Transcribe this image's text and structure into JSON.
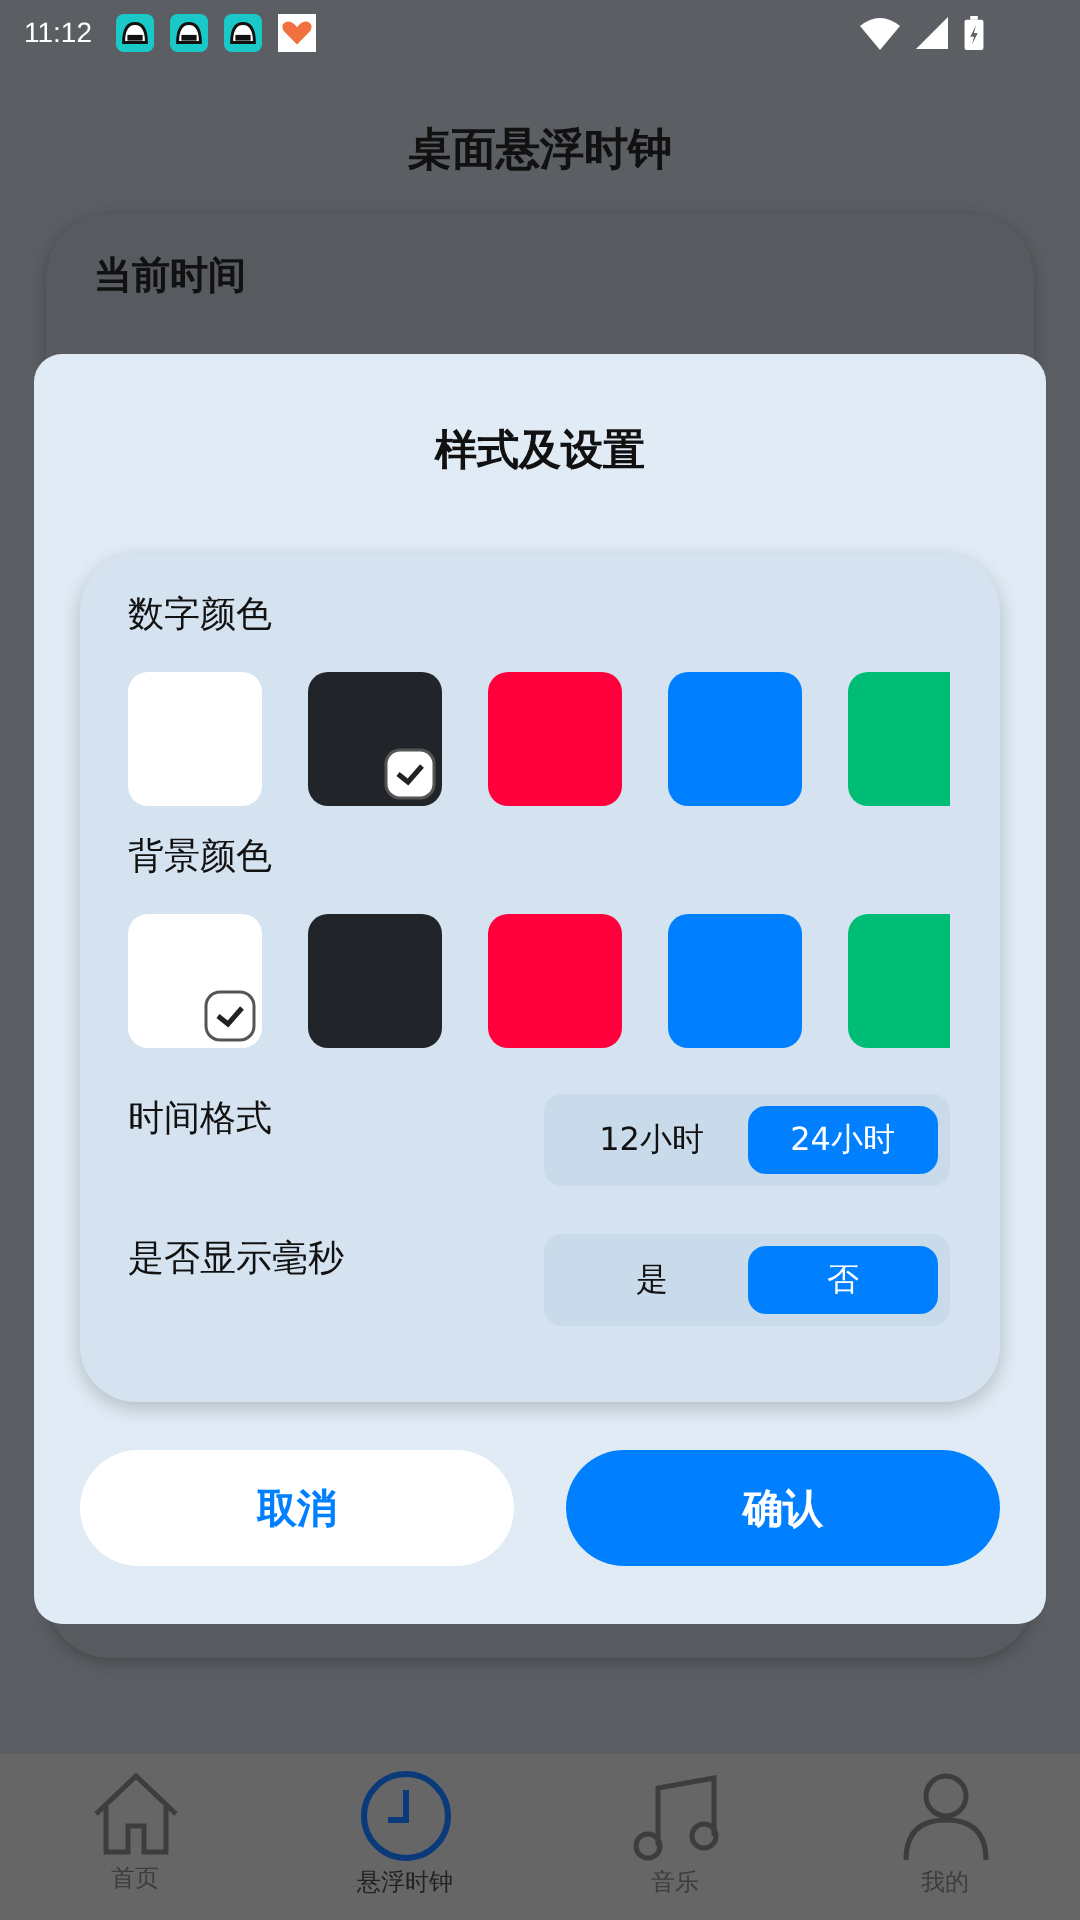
{
  "status_bar": {
    "time": "11:12",
    "notifications": [
      {
        "kind": "robot"
      },
      {
        "kind": "robot"
      },
      {
        "kind": "robot"
      },
      {
        "kind": "heart"
      }
    ]
  },
  "page": {
    "title": "桌面悬浮时钟",
    "card_title": "当前时间"
  },
  "dialog": {
    "title": "样式及设置",
    "digit_color": {
      "label": "数字颜色",
      "swatches": [
        {
          "color": "#ffffff",
          "selected": false
        },
        {
          "color": "#212529",
          "selected": true
        },
        {
          "color": "#ff003c",
          "selected": false
        },
        {
          "color": "#0080ff",
          "selected": false
        },
        {
          "color": "#00bd76",
          "selected": false
        }
      ]
    },
    "background_color": {
      "label": "背景颜色",
      "swatches": [
        {
          "color": "#ffffff",
          "selected": true
        },
        {
          "color": "#212529",
          "selected": false
        },
        {
          "color": "#ff003c",
          "selected": false
        },
        {
          "color": "#0080ff",
          "selected": false
        },
        {
          "color": "#00bd76",
          "selected": false
        }
      ]
    },
    "time_format": {
      "label": "时间格式",
      "options": [
        {
          "label": "12小时",
          "selected": false
        },
        {
          "label": "24小时",
          "selected": true
        }
      ]
    },
    "show_ms": {
      "label": "是否显示毫秒",
      "options": [
        {
          "label": "是",
          "selected": false
        },
        {
          "label": "否",
          "selected": true
        }
      ]
    },
    "buttons": [
      {
        "label": "取消",
        "kind": "secondary"
      },
      {
        "label": "确认",
        "kind": "primary"
      }
    ]
  },
  "nav": [
    {
      "label": "首页",
      "kind": "home",
      "selected": false
    },
    {
      "label": "悬浮时钟",
      "kind": "clock",
      "selected": true
    },
    {
      "label": "音乐",
      "kind": "music",
      "selected": false
    },
    {
      "label": "我的",
      "kind": "user",
      "selected": false
    }
  ]
}
